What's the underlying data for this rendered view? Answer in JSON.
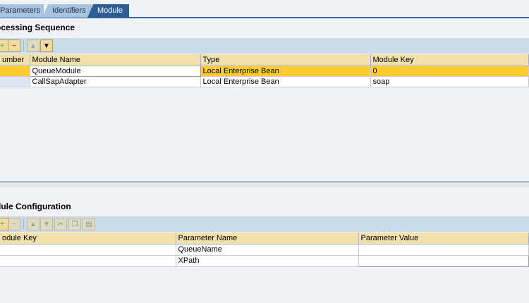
{
  "tabs": [
    {
      "label": "Parameters",
      "active": false
    },
    {
      "label": "Identifiers",
      "active": false
    },
    {
      "label": "Module",
      "active": true
    }
  ],
  "processing": {
    "title": "ocessing Sequence",
    "toolbar": [
      "insert-row-icon",
      "delete-row-icon",
      "move-up-icon",
      "move-down-icon"
    ],
    "columns": [
      "umber",
      "Module Name",
      "Type",
      "Module Key"
    ],
    "rows": [
      {
        "number": "",
        "name": "QueueModule",
        "type": "Local Enterprise Bean",
        "key": "0",
        "selected": true
      },
      {
        "number": "",
        "name": "CallSapAdapter",
        "type": "Local Enterprise Bean",
        "key": "soap",
        "selected": false
      }
    ]
  },
  "config": {
    "title": "dule Configuration",
    "toolbar": [
      "insert-row-icon",
      "delete-row-icon",
      "move-up-icon",
      "move-down-icon",
      "cut-icon",
      "copy-icon",
      "paste-icon"
    ],
    "columns": [
      "odule Key",
      "Parameter Name",
      "Parameter Value"
    ],
    "rows": [
      {
        "key": "",
        "name": "QueueName",
        "value": ""
      },
      {
        "key": "",
        "name": "XPath",
        "value": ""
      }
    ]
  },
  "colors": {
    "selected": "#ffcc33",
    "header": "#f2e1ad",
    "toolbar": "#ccdbea",
    "activeTab": "#2d5f92"
  }
}
